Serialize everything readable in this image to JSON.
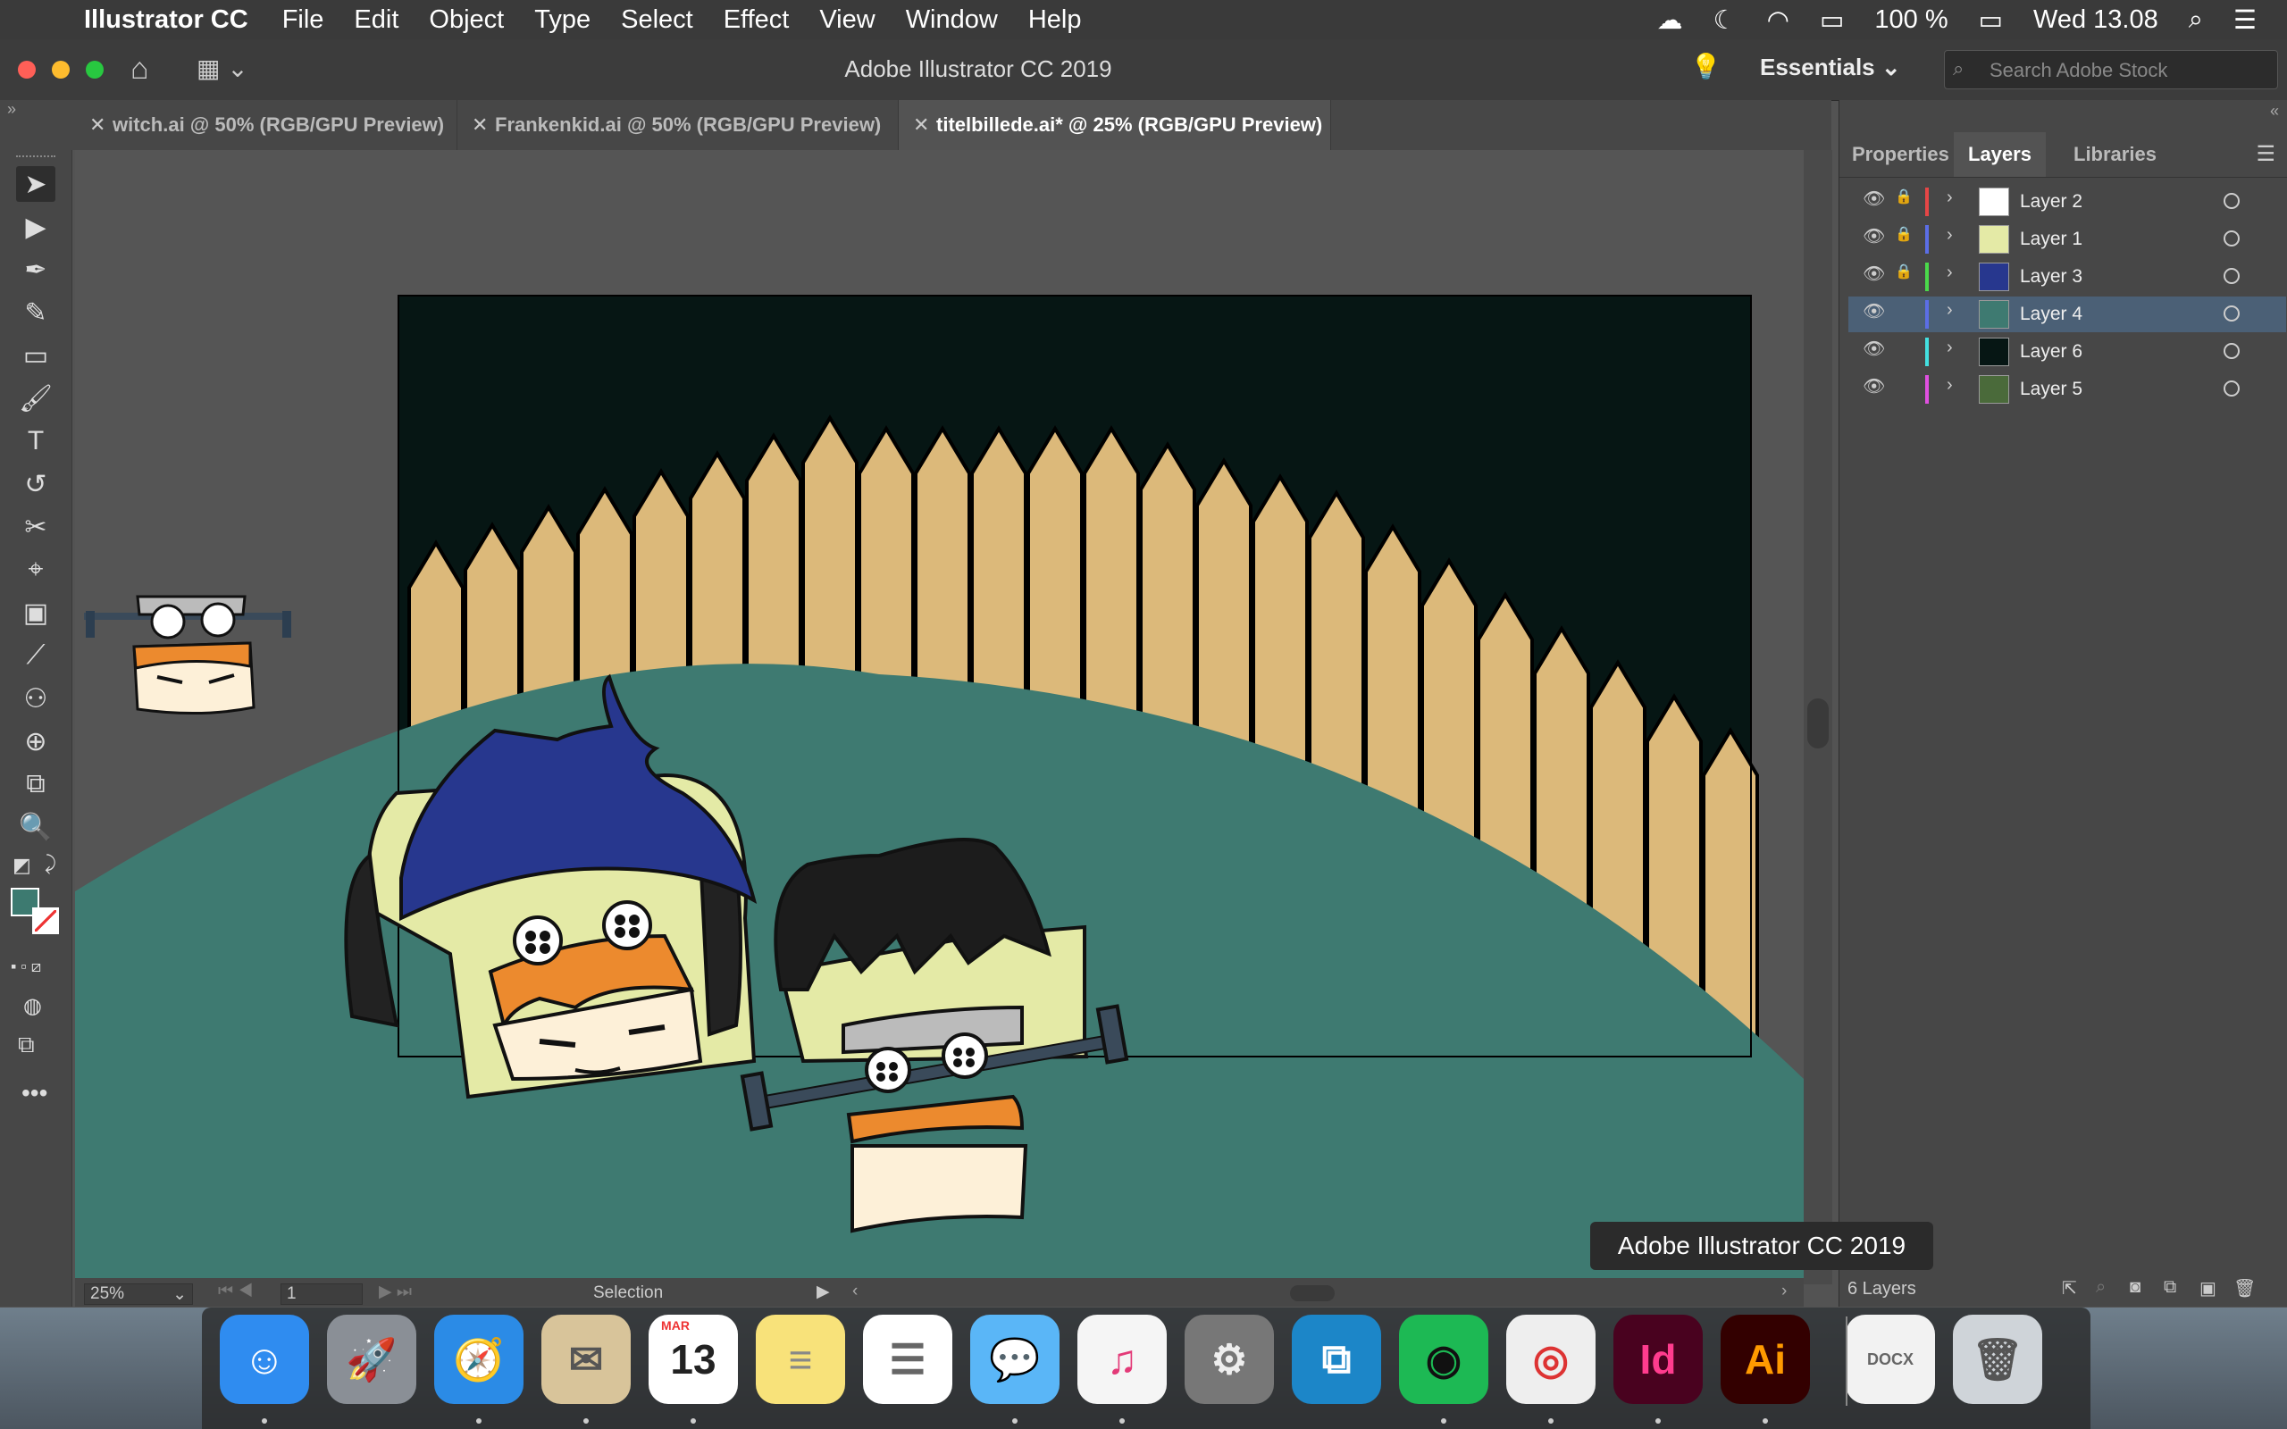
{
  "menubar": {
    "app_name": "Illustrator CC",
    "items": [
      "File",
      "Edit",
      "Object",
      "Type",
      "Select",
      "Effect",
      "View",
      "Window",
      "Help"
    ],
    "battery": "100 %",
    "clock": "Wed 13.08"
  },
  "titlebar": {
    "title": "Adobe Illustrator CC 2019",
    "workspace": "Essentials",
    "search_placeholder": "Search Adobe Stock"
  },
  "tabs": [
    {
      "label": "witch.ai @ 50% (RGB/GPU Preview)"
    },
    {
      "label": "Frankenkid.ai @ 50% (RGB/GPU Preview)"
    },
    {
      "label": "titelbillede.ai* @ 25% (RGB/GPU Preview)"
    }
  ],
  "tools": [
    "selection-tool",
    "direct-selection-tool",
    "pen-tool",
    "curvature-tool",
    "rectangle-tool",
    "paintbrush-tool",
    "type-tool",
    "rotate-tool",
    "scissors-tool",
    "puppet-warp-tool",
    "gradient-tool",
    "eyedropper-tool",
    "blend-tool",
    "shape-builder-tool",
    "artboard-tool",
    "zoom-tool"
  ],
  "tool_glyphs": [
    "➤",
    "▶",
    "✒",
    "✎",
    "▭",
    "🖌",
    "T",
    "↺",
    "✂",
    "⌖",
    "▣",
    "⟋",
    "⚇",
    "⊕",
    "⧉",
    "🔍"
  ],
  "colors": {
    "fill": "#3d7a70",
    "night": "#061614",
    "hill": "#3e7a71",
    "fence": "#dcb97a",
    "skin": "#e4eaa6",
    "hat": "#27378e",
    "hair_orange": "#ec8a2e"
  },
  "statusbar": {
    "zoom": "25%",
    "artboard": "1",
    "tool": "Selection"
  },
  "panel": {
    "tabs": [
      "Properties",
      "Layers",
      "Libraries"
    ],
    "active_tab": "Layers",
    "layers": [
      {
        "name": "Layer 2",
        "color": "#e64646",
        "locked": true,
        "selected": false,
        "thumb": "#ffffff"
      },
      {
        "name": "Layer 1",
        "color": "#5b6ee6",
        "locked": true,
        "selected": false,
        "thumb": "#e4eaa6"
      },
      {
        "name": "Layer 3",
        "color": "#4ad94a",
        "locked": true,
        "selected": false,
        "thumb": "#27378e"
      },
      {
        "name": "Layer 4",
        "color": "#5b6ee6",
        "locked": false,
        "selected": true,
        "thumb": "#3e7a71"
      },
      {
        "name": "Layer 6",
        "color": "#43e0e0",
        "locked": false,
        "selected": false,
        "thumb": "#061614"
      },
      {
        "name": "Layer 5",
        "color": "#e050e0",
        "locked": false,
        "selected": false,
        "thumb": "#4a6a3a"
      }
    ],
    "layer_count": "6 Layers"
  },
  "tooltip": "Adobe Illustrator CC 2019",
  "dock": [
    {
      "name": "finder",
      "glyph": "☺",
      "bg": "#2f8cf0",
      "fg": "#fff",
      "running": true
    },
    {
      "name": "launchpad",
      "glyph": "🚀",
      "bg": "#8a8f96",
      "fg": "#fff",
      "running": false
    },
    {
      "name": "safari",
      "glyph": "🧭",
      "bg": "#2b8be6",
      "fg": "#fff",
      "running": true
    },
    {
      "name": "mail",
      "glyph": "✉",
      "bg": "#d8c49a",
      "fg": "#555",
      "running": true
    },
    {
      "name": "calendar",
      "glyph": "13",
      "bg": "#ffffff",
      "fg": "#222",
      "running": true
    },
    {
      "name": "notes",
      "glyph": "≡",
      "bg": "#f8e27a",
      "fg": "#888",
      "running": false
    },
    {
      "name": "reminders",
      "glyph": "☰",
      "bg": "#ffffff",
      "fg": "#666",
      "running": false
    },
    {
      "name": "messages",
      "glyph": "💬",
      "bg": "#5ab6f7",
      "fg": "#fff",
      "running": true
    },
    {
      "name": "itunes",
      "glyph": "♫",
      "bg": "#f5f5f5",
      "fg": "#e33a78",
      "running": true
    },
    {
      "name": "system-preferences",
      "glyph": "⚙",
      "bg": "#777",
      "fg": "#eee",
      "running": false
    },
    {
      "name": "mosaic",
      "glyph": "⧉",
      "bg": "#1c86c8",
      "fg": "#fff",
      "running": false
    },
    {
      "name": "spotify",
      "glyph": "◉",
      "bg": "#1db954",
      "fg": "#111",
      "running": true
    },
    {
      "name": "chrome",
      "glyph": "◎",
      "bg": "#eeeeee",
      "fg": "#d33",
      "running": true
    },
    {
      "name": "indesign",
      "glyph": "Id",
      "bg": "#49021f",
      "fg": "#ff3c8e",
      "running": true
    },
    {
      "name": "illustrator",
      "glyph": "Ai",
      "bg": "#330000",
      "fg": "#ff9a00",
      "running": true
    },
    {
      "name": "docx-file",
      "glyph": "DOCX",
      "bg": "#f2f2f2",
      "fg": "#666",
      "running": false
    },
    {
      "name": "trash",
      "glyph": "🗑",
      "bg": "#cfd4d9",
      "fg": "#555",
      "running": false
    }
  ],
  "calendar_month": "MAR"
}
